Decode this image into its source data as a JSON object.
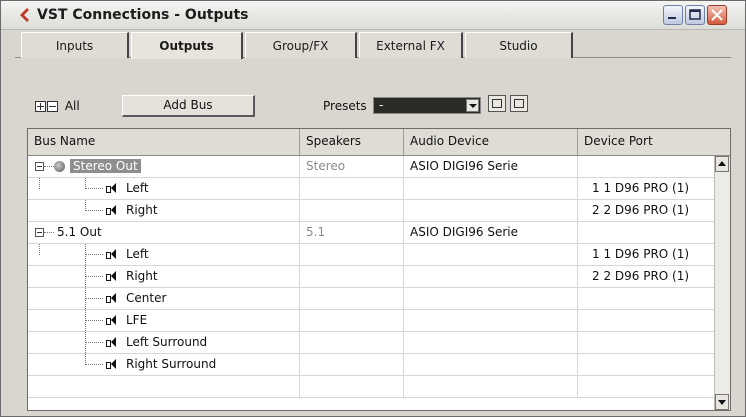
{
  "window": {
    "title": "VST Connections - Outputs"
  },
  "tabs": [
    {
      "label": "Inputs",
      "active": false
    },
    {
      "label": "Outputs",
      "active": true
    },
    {
      "label": "Group/FX",
      "active": false
    },
    {
      "label": "External FX",
      "active": false
    },
    {
      "label": "Studio",
      "active": false
    }
  ],
  "toolbar": {
    "all_label": "All",
    "add_bus_label": "Add Bus",
    "presets_label": "Presets",
    "presets_value": "-"
  },
  "table": {
    "columns": [
      "Bus Name",
      "Speakers",
      "Audio Device",
      "Device Port"
    ],
    "rows": [
      {
        "name": "Stereo Out",
        "speakers": "Stereo",
        "device": "ASIO DIGI96 Serie",
        "port": ""
      },
      {
        "name": "Left",
        "speakers": "",
        "device": "",
        "port": "1 1 D96 PRO (1)"
      },
      {
        "name": "Right",
        "speakers": "",
        "device": "",
        "port": "2 2 D96 PRO (1)"
      },
      {
        "name": "5.1 Out",
        "speakers": "5.1",
        "device": "ASIO DIGI96 Serie",
        "port": ""
      },
      {
        "name": "Left",
        "speakers": "",
        "device": "",
        "port": "1 1 D96 PRO (1)"
      },
      {
        "name": "Right",
        "speakers": "",
        "device": "",
        "port": "2 2 D96 PRO (1)"
      },
      {
        "name": "Center",
        "speakers": "",
        "device": "",
        "port": ""
      },
      {
        "name": "LFE",
        "speakers": "",
        "device": "",
        "port": ""
      },
      {
        "name": "Left Surround",
        "speakers": "",
        "device": "",
        "port": ""
      },
      {
        "name": "Right Surround",
        "speakers": "",
        "device": "",
        "port": ""
      }
    ]
  },
  "colors": {
    "accent": "#c0392b",
    "selected_bg": "#8e8e8e"
  }
}
